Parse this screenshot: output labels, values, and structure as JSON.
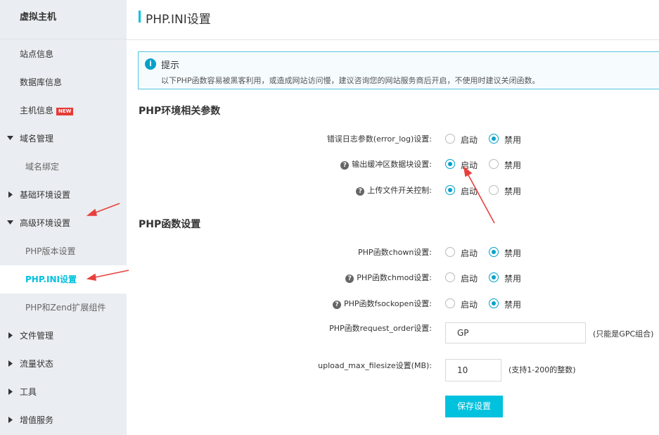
{
  "sidebar": {
    "title": "虚拟主机",
    "items": [
      {
        "label": "站点信息"
      },
      {
        "label": "数据库信息"
      },
      {
        "label": "主机信息",
        "badge": "NEW"
      },
      {
        "label": "域名管理",
        "caret": "down"
      },
      {
        "label": "域名绑定"
      },
      {
        "label": "基础环境设置",
        "caret": "right"
      },
      {
        "label": "高级环境设置",
        "caret": "down"
      },
      {
        "label": "PHP版本设置"
      },
      {
        "label": "PHP.INI设置",
        "active": true
      },
      {
        "label": "PHP和Zend扩展组件"
      },
      {
        "label": "文件管理",
        "caret": "right"
      },
      {
        "label": "流量状态",
        "caret": "right"
      },
      {
        "label": "工具",
        "caret": "right"
      },
      {
        "label": "增值服务",
        "caret": "right"
      }
    ]
  },
  "header": {
    "title": "PHP.INI设置"
  },
  "tip": {
    "icon": "info-icon",
    "title": "提示",
    "text": "以下PHP函数容易被黑客利用，或造成网站访问慢，建议咨询您的网站服务商后开启，不使用时建议关闭函数。"
  },
  "env_section": {
    "title": "PHP环境相关参数",
    "rows": [
      {
        "label": "错误日志参数(error_log)设置:",
        "help": false,
        "enable": "启动",
        "disable": "禁用",
        "selected": "禁用"
      },
      {
        "label": "输出缓冲区数据块设置:",
        "help": true,
        "enable": "启动",
        "disable": "禁用",
        "selected": "启动"
      },
      {
        "label": "上传文件开关控制:",
        "help": true,
        "enable": "启动",
        "disable": "禁用",
        "selected": "启动"
      }
    ]
  },
  "func_section": {
    "title": "PHP函数设置",
    "rows": [
      {
        "label": "PHP函数chown设置:",
        "help": false,
        "enable": "启动",
        "disable": "禁用",
        "selected": "禁用"
      },
      {
        "label": "PHP函数chmod设置:",
        "help": true,
        "enable": "启动",
        "disable": "禁用",
        "selected": "禁用"
      },
      {
        "label": "PHP函数fsockopen设置:",
        "help": true,
        "enable": "启动",
        "disable": "禁用",
        "selected": "禁用"
      }
    ],
    "request_order": {
      "label": "PHP函数request_order设置:",
      "value": "GP",
      "hint": "(只能是GPC组合)"
    },
    "upload_max": {
      "label": "upload_max_filesize设置(MB):",
      "value": "10",
      "hint": "(支持1-200的整数)"
    }
  },
  "save_button": "保存设置",
  "colors": {
    "accent": "#00c1de",
    "radio": "#00a2ca",
    "sidebar_bg": "#eaedf1",
    "arrow": "#e8403c"
  }
}
